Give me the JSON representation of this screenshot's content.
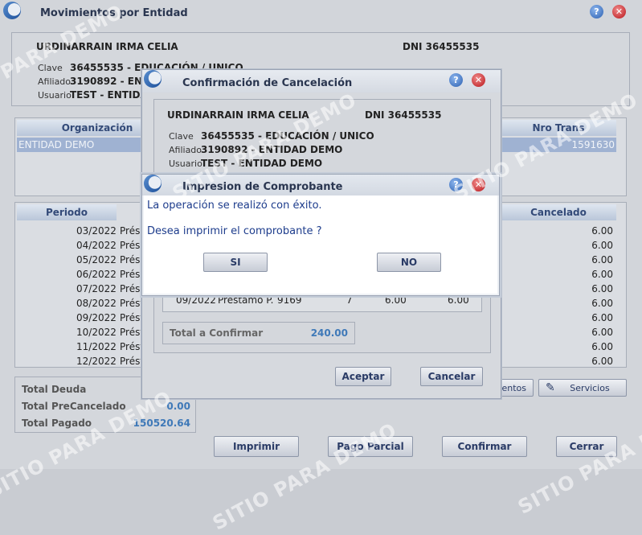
{
  "main": {
    "title": "Movimientos por Entidad",
    "person_name": "URDINARRAIN IRMA CELIA",
    "dni": "DNI 36455535",
    "clave_label": "Clave",
    "clave_value": "36455535 - EDUCACIÓN / UNICO",
    "afiliado_label": "Afiliado",
    "afiliado_value": "3190892 - ENT",
    "usuario_label": "Usuario",
    "usuario_value": "TEST - ENTIDAD",
    "grid1": {
      "col_org": "Organización",
      "col_nro": "Nro Trans",
      "row_org": "ENTIDAD DEMO",
      "row_nro": "1591630"
    },
    "grid2": {
      "col_periodo": "Periodo",
      "col_cancelado": "Cancelado",
      "rows": [
        {
          "periodo": "03/2022",
          "desc": "Prést",
          "cancelado": "6.00"
        },
        {
          "periodo": "04/2022",
          "desc": "Prést",
          "cancelado": "6.00"
        },
        {
          "periodo": "05/2022",
          "desc": "Prést",
          "cancelado": "6.00"
        },
        {
          "periodo": "06/2022",
          "desc": "Prést",
          "cancelado": "6.00"
        },
        {
          "periodo": "07/2022",
          "desc": "Prést",
          "cancelado": "6.00"
        },
        {
          "periodo": "08/2022",
          "desc": "Prést",
          "cancelado": "6.00"
        },
        {
          "periodo": "09/2022",
          "desc": "Prést",
          "cancelado": "6.00"
        },
        {
          "periodo": "10/2022",
          "desc": "Prést",
          "cancelado": "6.00"
        },
        {
          "periodo": "11/2022",
          "desc": "Prést",
          "cancelado": "6.00"
        },
        {
          "periodo": "12/2022",
          "desc": "Prést",
          "cancelado": "6.00"
        }
      ]
    },
    "totals": {
      "deuda_label": "Total Deuda",
      "precancelado_label": "Total PreCancelado",
      "precancelado_value": "0.00",
      "pagado_label": "Total Pagado",
      "pagado_value": "150520.64"
    },
    "side_buttons": {
      "movimientos": "ientos",
      "servicios": "Servicios"
    },
    "buttons": {
      "imprimir": "Imprimir",
      "pago_parcial": "Pago Parcial",
      "confirmar": "Confirmar",
      "cerrar": "Cerrar"
    }
  },
  "confirm": {
    "title": "Confirmación de Cancelación",
    "person_name": "URDINARRAIN IRMA CELIA",
    "dni": "DNI 36455535",
    "clave_label": "Clave",
    "clave_value": "36455535 - EDUCACIÓN / UNICO",
    "afiliado_label": "Afiliado",
    "afiliado_value": "3190892 - ENTIDAD DEMO",
    "usuario_label": "Usuario",
    "usuario_value": "TEST - ENTIDAD DEMO",
    "last_row": {
      "periodo": "09/2022",
      "desc": "Préstamo P.",
      "nro": "9169",
      "cuota": "7",
      "importe": "6.00",
      "cancelado": "6.00"
    },
    "total_label": "Total a Confirmar",
    "total_value": "240.00",
    "aceptar": "Aceptar",
    "cancelar": "Cancelar"
  },
  "dialog": {
    "title": "Impresion de Comprobante",
    "message": "La operación se realizó con éxito.",
    "question": "Desea imprimir el comprobante ?",
    "yes": "SI",
    "no": "NO"
  },
  "watermark": [
    "SITIO PARA DEMO",
    "SITIO PARA DEMO",
    "SITIO PARA DEMO",
    "SITIO PARA DEMO",
    "SITIO PARA DEMO"
  ],
  "icons": {
    "help": "?",
    "close": "✕"
  }
}
